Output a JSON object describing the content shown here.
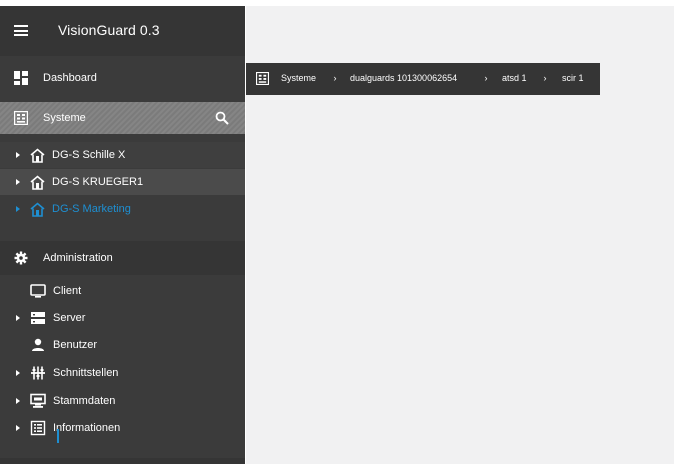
{
  "app": {
    "title": "VisionGuard 0.3"
  },
  "sidebar": {
    "dashboard_label": "Dashboard",
    "systeme_label": "Systeme",
    "systems": [
      {
        "label": "DG-S Schille X"
      },
      {
        "label": "DG-S KRUEGER1"
      },
      {
        "label": "DG-S Marketing"
      }
    ],
    "administration_label": "Administration",
    "admin_items": [
      {
        "label": "Client",
        "icon": "monitor-icon",
        "expandable": false
      },
      {
        "label": "Server",
        "icon": "server-icon",
        "expandable": true
      },
      {
        "label": "Benutzer",
        "icon": "user-icon",
        "expandable": false
      },
      {
        "label": "Schnittstellen",
        "icon": "interfaces-icon",
        "expandable": true
      },
      {
        "label": "Stammdaten",
        "icon": "master-data-icon",
        "expandable": true
      },
      {
        "label": "Informationen",
        "icon": "info-list-icon",
        "expandable": true
      }
    ]
  },
  "breadcrumb": {
    "items": [
      {
        "label": "Systeme"
      },
      {
        "label": "dualguards 101300062654"
      },
      {
        "label": "atsd 1"
      },
      {
        "label": "scir 1"
      }
    ],
    "separator": "›"
  },
  "colors": {
    "sidebar_bg": "#3b3b3b",
    "active_link": "#1e8fd2",
    "content_bg": "#f1f1f2"
  }
}
